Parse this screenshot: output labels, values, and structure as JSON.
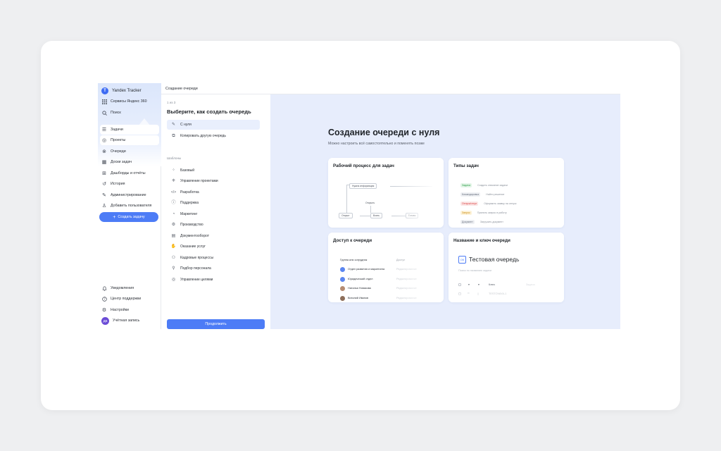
{
  "sidebar": {
    "app_name": "Yandex Tracker",
    "logo_letter": "T",
    "services": "Сервисы Яндекс 360",
    "search": "Поиск",
    "nav": [
      {
        "label": "Задачи",
        "icon": "list-icon"
      },
      {
        "label": "Проекты",
        "icon": "projects-icon"
      },
      {
        "label": "Очереди",
        "icon": "queues-icon"
      },
      {
        "label": "Доски задач",
        "icon": "board-icon"
      },
      {
        "label": "Дашборды и отчёты",
        "icon": "dashboard-icon"
      },
      {
        "label": "История",
        "icon": "history-icon"
      },
      {
        "label": "Администрирование",
        "icon": "wrench-icon"
      },
      {
        "label": "Добавить пользователя",
        "icon": "add-user-icon"
      }
    ],
    "create_task": "Создать задачу",
    "bottom": [
      {
        "label": "Уведомления",
        "icon": "bell-icon"
      },
      {
        "label": "Центр поддержки",
        "icon": "help-icon"
      },
      {
        "label": "Настройки",
        "icon": "gear-icon"
      },
      {
        "label": "Учётная запись",
        "icon": "avatar"
      }
    ],
    "avatar_initials": "ДВ"
  },
  "topbar": {
    "title": "Создание очереди"
  },
  "options": {
    "step": "1 из 3",
    "heading": "Выберите, как создать очередь",
    "top_options": [
      {
        "label": "С нуля",
        "icon": "pencil-icon"
      },
      {
        "label": "Копировать другую очередь",
        "icon": "copy-icon"
      }
    ],
    "templates_label": "Шаблоны",
    "templates": [
      {
        "label": "Базовый",
        "icon": "grid-icon"
      },
      {
        "label": "Управление проектами",
        "icon": "projects-icon"
      },
      {
        "label": "Разработка",
        "icon": "code-icon"
      },
      {
        "label": "Поддержка",
        "icon": "help-icon"
      },
      {
        "label": "Маркетинг",
        "icon": "megaphone-icon"
      },
      {
        "label": "Производство",
        "icon": "factory-icon"
      },
      {
        "label": "Документооборот",
        "icon": "document-icon"
      },
      {
        "label": "Оказание услуг",
        "icon": "hand-icon"
      },
      {
        "label": "Кадровые процессы",
        "icon": "people-icon"
      },
      {
        "label": "Подбор персонала",
        "icon": "search-person-icon"
      },
      {
        "label": "Управление целями",
        "icon": "target-icon"
      }
    ],
    "continue": "Продолжить"
  },
  "preview": {
    "title": "Создание очереди с нуля",
    "subtitle": "Можно настроить всё самостоятельно и поменять позже",
    "workflow": {
      "title": "Рабочий процесс для задач",
      "nodes": [
        "Нужна информация",
        "Открыть",
        "Открыт",
        "Взять",
        "Готово"
      ]
    },
    "types": {
      "title": "Типы задач",
      "rows": [
        {
          "tag": "Задача",
          "color": "#2e9e4a",
          "bg": "#e3f5e7",
          "desc": "Создать описание задачи"
        },
        {
          "tag": "Командировка",
          "color": "#6b7280",
          "bg": "#eef0f3",
          "desc": "Найти решение"
        },
        {
          "tag": "Отпуск/отгул",
          "color": "#d93c3c",
          "bg": "#fbe6e6",
          "desc": "Оформить заявку на отпуск"
        },
        {
          "tag": "Запрос",
          "color": "#c98a0a",
          "bg": "#fdf2d8",
          "desc": "Принять запрос в работу"
        },
        {
          "tag": "Документ",
          "color": "#6b7280",
          "bg": "#eef0f3",
          "desc": "Загрузить документ"
        }
      ]
    },
    "access": {
      "title": "Доступ к очереди",
      "col_group": "Группа или сотрудник",
      "col_access": "Доступ",
      "rows": [
        {
          "name": "Отдел развития и маркетинга",
          "access": "Редактирование",
          "person": false
        },
        {
          "name": "Юридический отдел",
          "access": "Редактирование",
          "person": false
        },
        {
          "name": "Наталья Новикова",
          "access": "Редактирование",
          "person": true
        },
        {
          "name": "Виталий Иванов",
          "access": "Редактирование",
          "person": true
        }
      ]
    },
    "queue": {
      "title": "Название и ключ очереди",
      "icon_text": "ОК",
      "name": "Тестовая очередь",
      "placeholder": "Поиск по названию задачи",
      "col_key": "Ключ",
      "col_name": "Задача",
      "key_value": "TESTOVAYA-1"
    }
  }
}
